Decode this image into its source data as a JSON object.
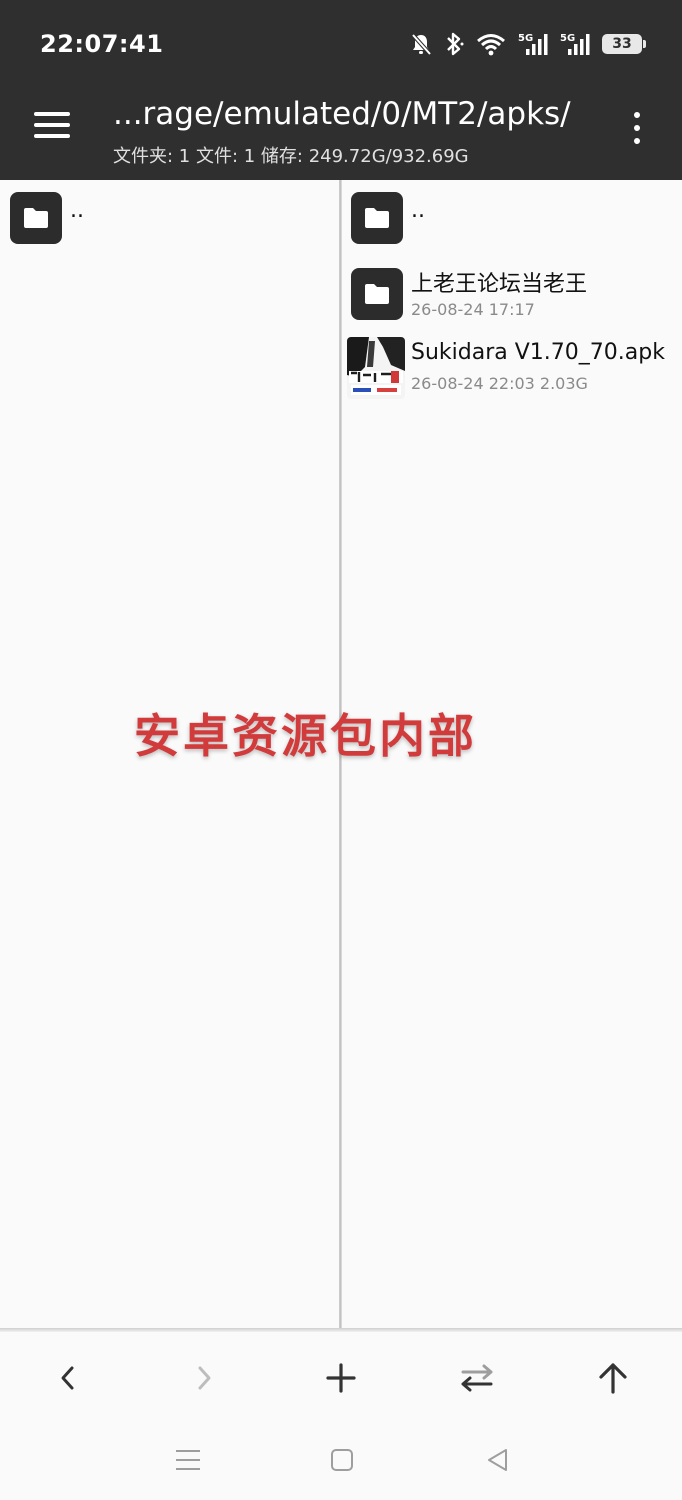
{
  "status_bar": {
    "time": "22:07:41",
    "battery": "33",
    "icons": [
      "mute-bell-icon",
      "bluetooth-icon",
      "wifi-icon",
      "signal-5g-icon",
      "signal-5g-icon",
      "battery-icon"
    ]
  },
  "header": {
    "path": "...rage/emulated/0/MT2/apks/",
    "summary": "文件夹: 1  文件: 1  储存: 249.72G/932.69G"
  },
  "left_pane": {
    "items": [
      {
        "name": "..",
        "icon": "folder-icon"
      }
    ]
  },
  "right_pane": {
    "items": [
      {
        "name": "..",
        "icon": "folder-icon"
      },
      {
        "name": "上老王论坛当老王",
        "meta": "26-08-24 17:17",
        "icon": "folder-icon"
      },
      {
        "name": "Sukidara V1.70_70.apk",
        "meta": "26-08-24 22:03  2.03G",
        "icon": "apk-thumbnail-icon"
      }
    ]
  },
  "watermark": "安卓资源包内部",
  "toolbar": {
    "buttons": [
      "back-arrow-icon",
      "forward-arrow-icon",
      "add-icon",
      "swap-icon",
      "up-arrow-icon"
    ]
  },
  "navbar": {
    "buttons": [
      "recents-icon",
      "home-icon",
      "back-triangle-icon"
    ]
  },
  "colors": {
    "header_bg": "#2f2f2f",
    "pane_bg": "#fafafa",
    "folder_icon_bg": "#2c2c2c",
    "watermark": "#d23b3b"
  }
}
